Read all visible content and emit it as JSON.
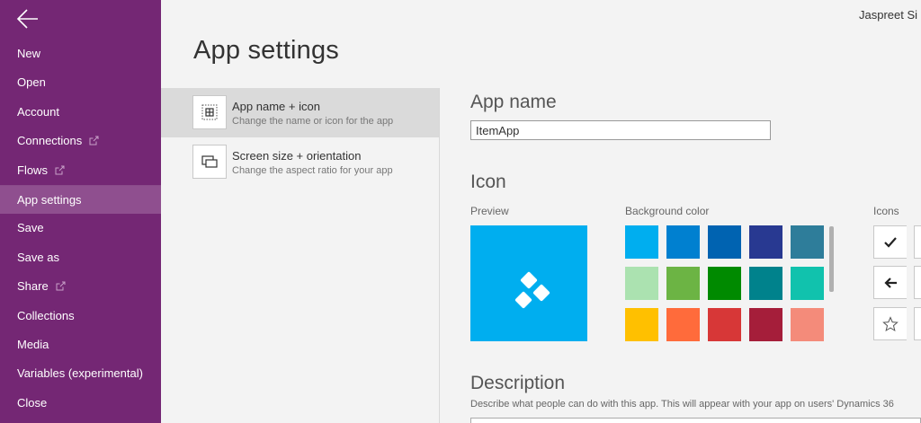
{
  "user": {
    "name": "Jaspreet Si"
  },
  "page": {
    "title": "App settings"
  },
  "nav": {
    "items": [
      {
        "label": "New",
        "external": false
      },
      {
        "label": "Open",
        "external": false
      },
      {
        "label": "Account",
        "external": false
      },
      {
        "label": "Connections",
        "external": true
      },
      {
        "label": "Flows",
        "external": true
      },
      {
        "label": "App settings",
        "external": false,
        "active": true
      },
      {
        "label": "Save",
        "external": false
      },
      {
        "label": "Save as",
        "external": false
      },
      {
        "label": "Share",
        "external": true
      },
      {
        "label": "Collections",
        "external": false
      },
      {
        "label": "Media",
        "external": false
      },
      {
        "label": "Variables (experimental)",
        "external": false
      },
      {
        "label": "Close",
        "external": false
      }
    ]
  },
  "settings": {
    "items": [
      {
        "title": "App name + icon",
        "subtitle": "Change the name or icon for the app",
        "icon": "app-grid-icon",
        "active": true
      },
      {
        "title": "Screen size + orientation",
        "subtitle": "Change the aspect ratio for your app",
        "icon": "screen-size-icon",
        "active": false
      }
    ]
  },
  "app_name": {
    "heading": "App name",
    "value": "ItemApp"
  },
  "icon_section": {
    "heading": "Icon",
    "preview_label": "Preview",
    "background_label": "Background color",
    "icons_label": "Icons",
    "preview_color": "#00aeef",
    "preview_icon": "app-logo-icon",
    "colors": [
      [
        "#00aeef",
        "#0080d0",
        "#0063b1",
        "#283991",
        "#2e7d9a"
      ],
      [
        "#abe2b0",
        "#6cb444",
        "#008a00",
        "#00828c",
        "#11c2ad"
      ],
      [
        "#ffc000",
        "#ff6b3b",
        "#d73737",
        "#a51e3a",
        "#f48b7a"
      ]
    ],
    "icons": [
      "checkmark-icon",
      "arrow-left-icon",
      "star-icon"
    ]
  },
  "description": {
    "heading": "Description",
    "help_text": "Describe what people can do with this app. This will appear with your app on users' Dynamics 36"
  },
  "theme": {
    "sidebar": "#742774",
    "sidebar_active": "#8f4f8f"
  }
}
